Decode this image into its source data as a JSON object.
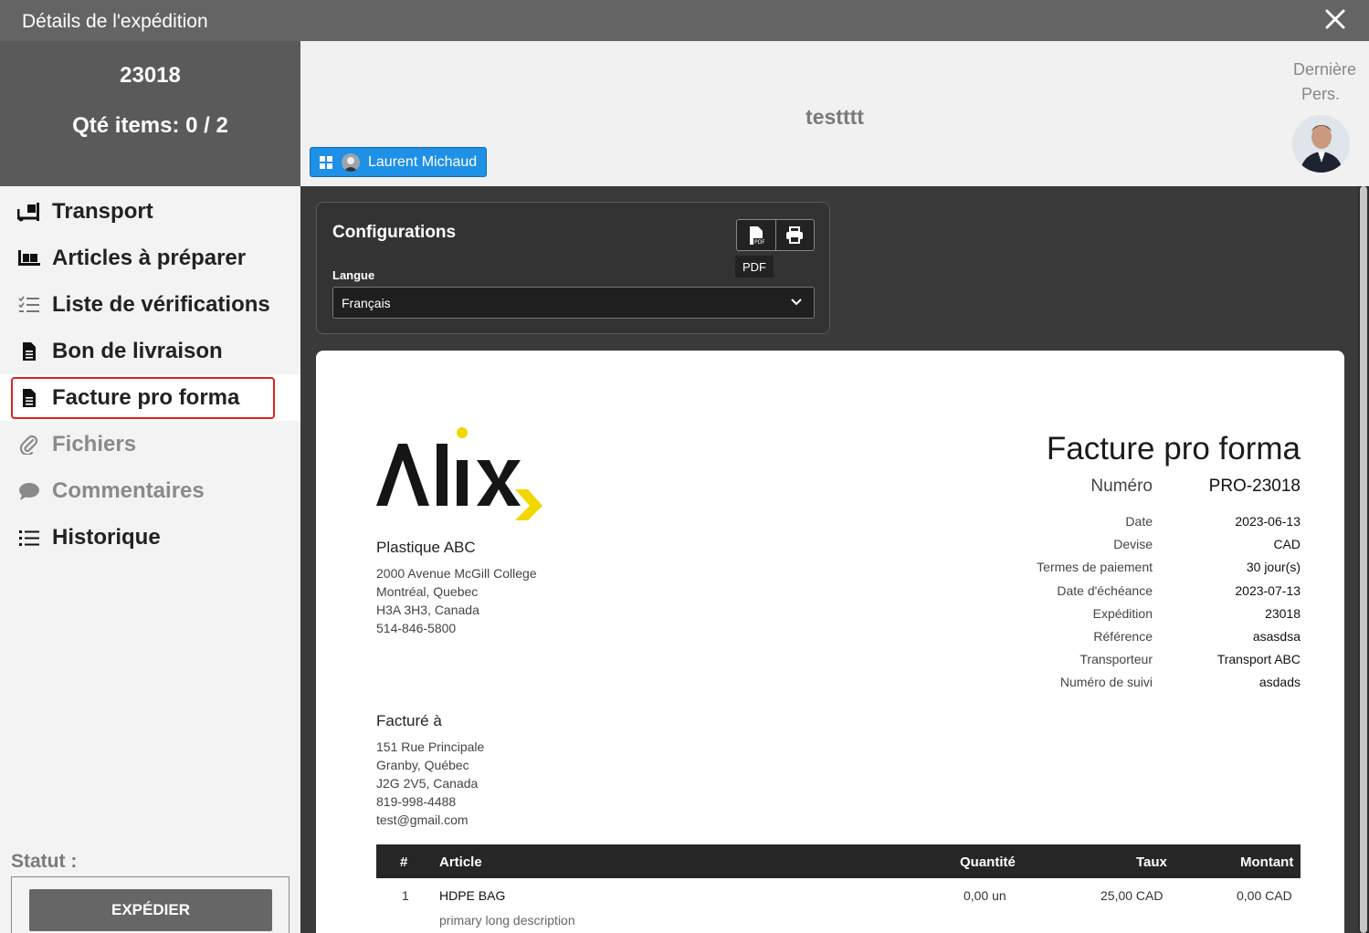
{
  "window": {
    "title": "Détails de l'expédition"
  },
  "sidebar": {
    "shipment_number": "23018",
    "qty_items": "Qté items: 0 / 2",
    "items": [
      {
        "label": "Transport",
        "icon": "truck-loading-icon"
      },
      {
        "label": "Articles à préparer",
        "icon": "pallet-boxes-icon"
      },
      {
        "label": "Liste de vérifications",
        "icon": "checklist-icon"
      },
      {
        "label": "Bon de livraison",
        "icon": "document-icon"
      },
      {
        "label": "Facture pro forma",
        "icon": "document-icon"
      },
      {
        "label": "Fichiers",
        "icon": "paperclip-icon"
      },
      {
        "label": "Commentaires",
        "icon": "comment-icon"
      },
      {
        "label": "Historique",
        "icon": "list-icon"
      }
    ],
    "status_label": "Statut :",
    "ship_button": "EXPÉDIER"
  },
  "header": {
    "title": "testttt",
    "user_chip": "Laurent Michaud",
    "last_pers_line1": "Dernière",
    "last_pers_line2": "Pers."
  },
  "config": {
    "title": "Configurations",
    "language_label": "Langue",
    "language_value": "Français",
    "tooltip": "PDF"
  },
  "invoice": {
    "title": "Facture pro forma",
    "seller": {
      "name": "Plastique ABC",
      "address": [
        "2000 Avenue McGill College",
        "Montréal, Quebec",
        "H3A 3H3, Canada",
        "514-846-5800"
      ]
    },
    "billed_to": {
      "label": "Facturé à",
      "address": [
        "151 Rue Principale",
        "Granby, Québec",
        "J2G 2V5, Canada",
        "819-998-4488",
        "test@gmail.com"
      ]
    },
    "number": {
      "label": "Numéro",
      "value": "PRO-23018"
    },
    "meta": [
      {
        "label": "Date",
        "value": "2023-06-13"
      },
      {
        "label": "Devise",
        "value": "CAD"
      },
      {
        "label": "Termes de paiement",
        "value": "30 jour(s)"
      },
      {
        "label": "Date d'échéance",
        "value": "2023-07-13"
      },
      {
        "label": "Expédition",
        "value": "23018"
      },
      {
        "label": "Référence",
        "value": "asasdsa"
      },
      {
        "label": "Transporteur",
        "value": "Transport ABC"
      },
      {
        "label": "Numéro de suivi",
        "value": "asdads"
      }
    ],
    "table": {
      "headers": {
        "num": "#",
        "article": "Article",
        "qty": "Quantité",
        "rate": "Taux",
        "amount": "Montant"
      },
      "rows": [
        {
          "num": "1",
          "article": "HDPE BAG",
          "description": "primary long description",
          "qty": "0,00 un",
          "rate": "25,00 CAD",
          "amount": "0,00 CAD"
        }
      ]
    }
  },
  "colors": {
    "accent_blue": "#1e90e6",
    "highlight_red": "#e02020",
    "logo_yellow": "#f2d600"
  }
}
